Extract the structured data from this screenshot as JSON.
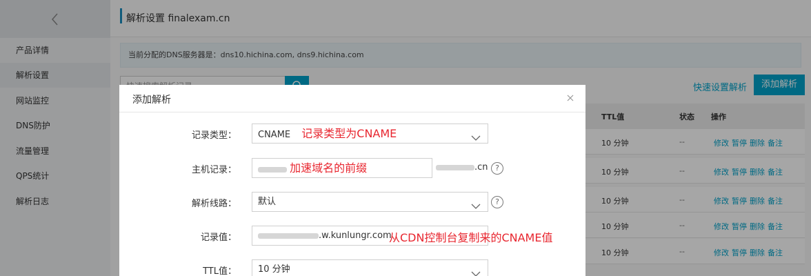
{
  "sidebar": {
    "items": [
      {
        "label": "产品详情"
      },
      {
        "label": "解析设置"
      },
      {
        "label": "网站监控"
      },
      {
        "label": "DNS防护"
      },
      {
        "label": "流量管理"
      },
      {
        "label": "QPS统计"
      },
      {
        "label": "解析日志"
      }
    ]
  },
  "header": {
    "title": "解析设置 finalexam.cn"
  },
  "notice": {
    "text": "当前分配的DNS服务器是：dns10.hichina.com, dns9.hichina.com"
  },
  "toolbar": {
    "search_placeholder": "快速搜索解析记录",
    "quick_setup_label": "快速设置解析",
    "add_label": "添加解析"
  },
  "table": {
    "headers": {
      "ttl": "TTL值",
      "status": "状态",
      "ops": "操作"
    },
    "rows": [
      {
        "ttl": "10 分钟",
        "status": "--",
        "ops": [
          "修改",
          "暂停",
          "删除",
          "备注"
        ]
      },
      {
        "ttl": "10 分钟",
        "status": "--",
        "ops": [
          "修改",
          "暂停",
          "删除",
          "备注"
        ]
      },
      {
        "ttl": "10 分钟",
        "status": "--",
        "ops": [
          "修改",
          "暂停",
          "删除",
          "备注"
        ]
      },
      {
        "ttl": "10 分钟",
        "status": "--",
        "ops": [
          "修改",
          "暂停",
          "删除",
          "备注"
        ]
      },
      {
        "ttl": "10 分钟",
        "status": "--",
        "ops": [
          "修改",
          "暂停",
          "删除",
          "备注"
        ]
      }
    ]
  },
  "modal": {
    "title": "添加解析",
    "close_icon": "close-icon",
    "fields": {
      "record_type": {
        "label": "记录类型：",
        "value": "CNAME",
        "annotation": "记录类型为CNAME"
      },
      "host": {
        "label": "主机记录：",
        "annotation": "加速域名的前缀",
        "suffix": ".cn"
      },
      "line": {
        "label": "解析线路：",
        "value": "默认"
      },
      "record_value": {
        "label": "记录值：",
        "value_visible": ".w.kunlungr.com",
        "annotation": "从CDN控制台复制来的CNAME值"
      },
      "ttl": {
        "label": "TTL值：",
        "value": "10 分钟"
      }
    }
  },
  "colors": {
    "accent": "#00a2ca",
    "annotation": "#e8262f"
  }
}
